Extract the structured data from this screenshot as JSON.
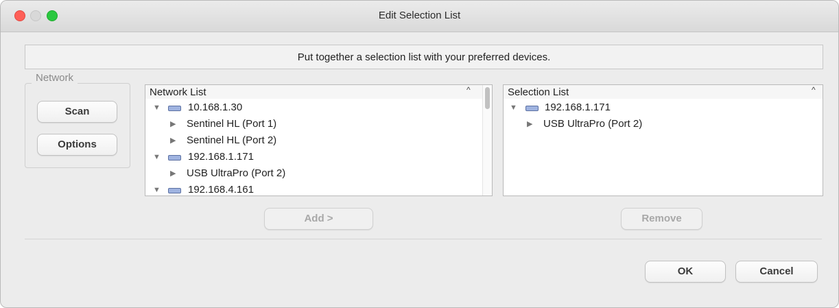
{
  "window": {
    "title": "Edit Selection List"
  },
  "banner": {
    "text": "Put together a selection list with your preferred devices."
  },
  "network_group": {
    "label": "Network",
    "scan_label": "Scan",
    "options_label": "Options"
  },
  "network_list": {
    "header": "Network List",
    "sort_indicator": "^",
    "items": [
      {
        "text": "10.168.1.30"
      },
      {
        "text": "Sentinel HL (Port 1)"
      },
      {
        "text": "Sentinel HL (Port 2)"
      },
      {
        "text": "192.168.1.171"
      },
      {
        "text": "USB UltraPro (Port 2)"
      },
      {
        "text": "192.168.4.161"
      }
    ]
  },
  "selection_list": {
    "header": "Selection List",
    "sort_indicator": "^",
    "items": [
      {
        "text": "192.168.1.171"
      },
      {
        "text": "USB UltraPro (Port 2)"
      }
    ]
  },
  "actions": {
    "add_label": "Add >",
    "remove_label": "Remove",
    "ok_label": "OK",
    "cancel_label": "Cancel"
  },
  "icons": {
    "expanded": "triangle-down-icon",
    "collapsed": "triangle-right-icon",
    "host": "network-host-icon"
  }
}
